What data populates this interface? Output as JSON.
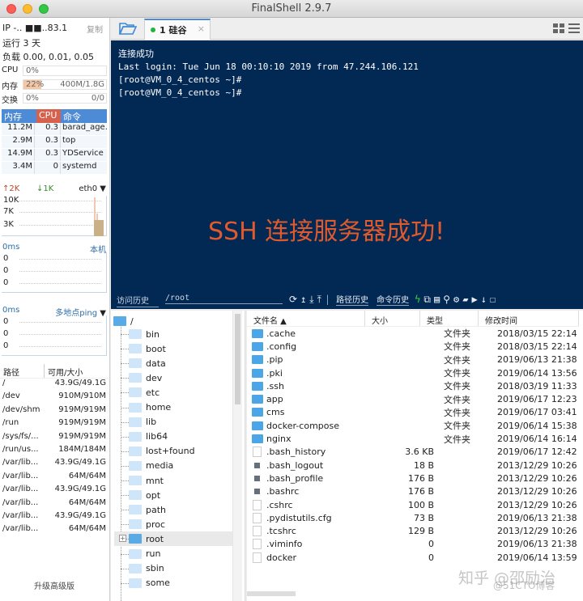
{
  "window": {
    "title": "FinalShell 2.9.7"
  },
  "sidebar": {
    "ip_label": "IP",
    "ip_value": "-.. ■■..83.1",
    "copy_label": "复制",
    "uptime": "运行 3 天",
    "load": "负载 0.00, 0.01, 0.05",
    "meters": [
      {
        "label": "CPU",
        "percent": "0%",
        "value": "",
        "fraction": 0.0
      },
      {
        "label": "内存",
        "percent": "22%",
        "value": "400M/1.8G",
        "fraction": 0.22
      },
      {
        "label": "交换",
        "percent": "0%",
        "value": "0/0",
        "fraction": 0.0
      }
    ],
    "process_table": {
      "headers": [
        "内存",
        "CPU",
        "命令"
      ],
      "rows": [
        {
          "mem": "11.2M",
          "cpu": "0.3",
          "cmd": "barad_age."
        },
        {
          "mem": "2.9M",
          "cpu": "0.3",
          "cmd": "top"
        },
        {
          "mem": "14.9M",
          "cpu": "0.3",
          "cmd": "YDService"
        },
        {
          "mem": "3.4M",
          "cpu": "0",
          "cmd": "systemd"
        }
      ]
    },
    "network": {
      "up": "↑2K",
      "down": "↓1K",
      "interface": "eth0",
      "axis": [
        "10K",
        "7K",
        "3K"
      ]
    },
    "ping_local": {
      "latency": "0ms",
      "target": "本机",
      "axis": [
        "0",
        "0",
        "0"
      ]
    },
    "ping_multi": {
      "latency": "0ms",
      "target": "多地点ping",
      "axis": [
        "0",
        "0",
        "0"
      ]
    },
    "disk_table": {
      "headers": [
        "路径",
        "可用/大小"
      ],
      "rows": [
        {
          "path": "/",
          "size": "43.9G/49.1G"
        },
        {
          "path": "/dev",
          "size": "910M/910M"
        },
        {
          "path": "/dev/shm",
          "size": "919M/919M"
        },
        {
          "path": "/run",
          "size": "919M/919M"
        },
        {
          "path": "/sys/fs/...",
          "size": "919M/919M"
        },
        {
          "path": "/run/us...",
          "size": "184M/184M"
        },
        {
          "path": "/var/lib...",
          "size": "43.9G/49.1G"
        },
        {
          "path": "/var/lib...",
          "size": "64M/64M"
        },
        {
          "path": "/var/lib...",
          "size": "43.9G/49.1G"
        },
        {
          "path": "/var/lib...",
          "size": "64M/64M"
        },
        {
          "path": "/var/lib...",
          "size": "43.9G/49.1G"
        },
        {
          "path": "/var/lib...",
          "size": "64M/64M"
        }
      ]
    },
    "upgrade_label": "升级高级版"
  },
  "tabs": [
    {
      "label": "1 硅谷",
      "status_color": "#26b33b",
      "close": "×"
    }
  ],
  "terminal": {
    "lines": [
      "连接成功",
      "Last login: Tue Jun 18 00:10:10 2019 from 47.244.106.121",
      "[root@VM_0_4_centos ~]#",
      "[root@VM_0_4_centos ~]#"
    ],
    "banner": "SSH 连接服务器成功!",
    "banner_color": "#e05a2d",
    "background": "#022854"
  },
  "terminal_bar": {
    "visit_history": "访问历史",
    "path": "/root",
    "path_history": "路径历史",
    "command_history": "命令历史"
  },
  "tree": {
    "root": "/",
    "items": [
      "bin",
      "boot",
      "data",
      "dev",
      "etc",
      "home",
      "lib",
      "lib64",
      "lost+found",
      "media",
      "mnt",
      "opt",
      "path",
      "proc",
      "root",
      "run",
      "sbin",
      "some"
    ],
    "selected": "root"
  },
  "files": {
    "headers": [
      "文件名 ▲",
      "大小",
      "类型",
      "修改时间"
    ],
    "rows": [
      {
        "name": ".cache",
        "size": "",
        "type": "文件夹",
        "time": "2018/03/15 22:14",
        "kind": "folder"
      },
      {
        "name": ".config",
        "size": "",
        "type": "文件夹",
        "time": "2018/03/15 22:14",
        "kind": "folder"
      },
      {
        "name": ".pip",
        "size": "",
        "type": "文件夹",
        "time": "2019/06/13 21:38",
        "kind": "folder"
      },
      {
        "name": ".pki",
        "size": "",
        "type": "文件夹",
        "time": "2019/06/14 13:56",
        "kind": "folder"
      },
      {
        "name": ".ssh",
        "size": "",
        "type": "文件夹",
        "time": "2018/03/19 11:33",
        "kind": "folder"
      },
      {
        "name": "app",
        "size": "",
        "type": "文件夹",
        "time": "2019/06/17 12:23",
        "kind": "folder"
      },
      {
        "name": "cms",
        "size": "",
        "type": "文件夹",
        "time": "2019/06/17 03:41",
        "kind": "folder"
      },
      {
        "name": "docker-compose",
        "size": "",
        "type": "文件夹",
        "time": "2019/06/14 15:38",
        "kind": "folder"
      },
      {
        "name": "nginx",
        "size": "",
        "type": "文件夹",
        "time": "2019/06/14 16:14",
        "kind": "folder"
      },
      {
        "name": ".bash_history",
        "size": "3.6 KB",
        "type": "",
        "time": "2019/06/17 12:42",
        "kind": "file"
      },
      {
        "name": ".bash_logout",
        "size": "18 B",
        "type": "",
        "time": "2013/12/29 10:26",
        "kind": "script"
      },
      {
        "name": ".bash_profile",
        "size": "176 B",
        "type": "",
        "time": "2013/12/29 10:26",
        "kind": "script"
      },
      {
        "name": ".bashrc",
        "size": "176 B",
        "type": "",
        "time": "2013/12/29 10:26",
        "kind": "script"
      },
      {
        "name": ".cshrc",
        "size": "100 B",
        "type": "",
        "time": "2013/12/29 10:26",
        "kind": "file"
      },
      {
        "name": ".pydistutils.cfg",
        "size": "73 B",
        "type": "",
        "time": "2019/06/13 21:38",
        "kind": "file"
      },
      {
        "name": ".tcshrc",
        "size": "129 B",
        "type": "",
        "time": "2013/12/29 10:26",
        "kind": "file"
      },
      {
        "name": ".viminfo",
        "size": "0",
        "type": "",
        "time": "2019/06/13 21:38",
        "kind": "file"
      },
      {
        "name": "docker",
        "size": "0",
        "type": "",
        "time": "2019/06/14 13:59",
        "kind": "file"
      }
    ]
  },
  "watermark": {
    "line1": "知乎 @邵励治",
    "line2": "@51CTO博客"
  }
}
